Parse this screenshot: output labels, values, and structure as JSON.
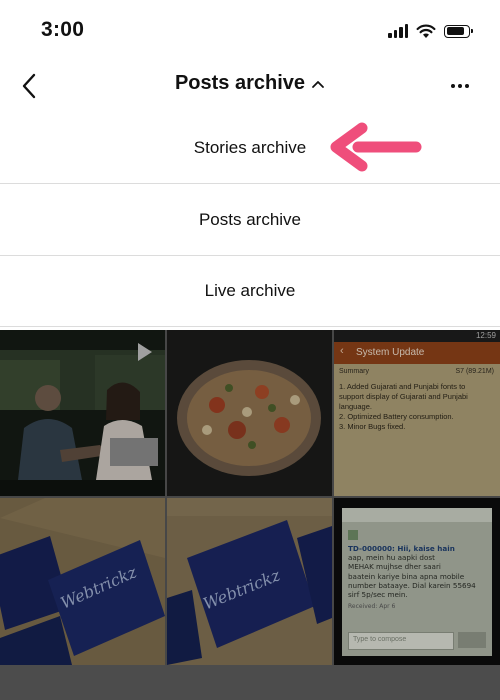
{
  "status_bar": {
    "time": "3:00",
    "icons": [
      "cellular-signal-icon",
      "wifi-icon",
      "battery-icon"
    ]
  },
  "nav": {
    "back_icon": "chevron-left-icon",
    "title": "Posts archive",
    "title_caret": "chevron-up-icon",
    "more_icon": "more-horizontal-icon"
  },
  "menu": {
    "items": [
      {
        "label": "Stories archive"
      },
      {
        "label": "Posts archive"
      },
      {
        "label": "Live archive"
      }
    ]
  },
  "annotation": {
    "arrow_icon": "pointer-arrow-icon",
    "color": "#ef4e7b"
  },
  "grid": {
    "cells": [
      {
        "kind": "video",
        "icon": "play-icon"
      },
      {
        "kind": "photo"
      },
      {
        "kind": "screenshot",
        "header": "System Update",
        "status_time": "12:59",
        "summary_label": "Summary",
        "size_label": "S7 (89.21M)",
        "lines": [
          "1. Added Gujarati and Punjabi fonts to",
          "support display of Gujarati and Punjabi",
          "language.",
          "2. Optimized Battery consumption.",
          "3. Minor Bugs fixed."
        ]
      },
      {
        "kind": "photo",
        "card_text": "Webtrickz"
      },
      {
        "kind": "photo",
        "card_text": "Webtrickz"
      },
      {
        "kind": "screenshot",
        "sms_lines": [
          "TD-000000: Hii, kaise hain",
          "aap, mein hu aapki dost",
          "MEHAK mujhse dher saari",
          "baatein kariye bina apna mobile",
          "number bataaye. Dial karein 55694",
          "sirf 5p/sec mein."
        ],
        "received": "Received: Apr 6",
        "compose_placeholder": "Type to compose"
      }
    ]
  },
  "colors": {
    "accent": "#ef4e7b",
    "divider": "#dcdcdc",
    "dim": "#545454"
  }
}
